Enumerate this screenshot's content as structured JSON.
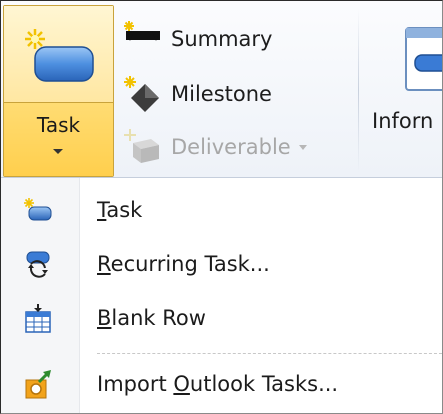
{
  "ribbon": {
    "task_button": {
      "label": "Task"
    },
    "items": [
      {
        "label": "Summary",
        "icon": "summary-icon",
        "enabled": true
      },
      {
        "label": "Milestone",
        "icon": "milestone-icon",
        "enabled": true
      },
      {
        "label": "Deliverable",
        "icon": "deliverable-icon",
        "enabled": false
      }
    ],
    "information": {
      "label": "Inforn",
      "icon": "information-icon"
    }
  },
  "menu": {
    "items": [
      {
        "pre": "",
        "key": "T",
        "post": "ask",
        "icon": "task-icon"
      },
      {
        "pre": "",
        "key": "R",
        "post": "ecurring Task...",
        "icon": "recurring-task-icon"
      },
      {
        "pre": "",
        "key": "B",
        "post": "lank Row",
        "icon": "blank-row-icon"
      },
      {
        "pre": "Import ",
        "key": "O",
        "post": "utlook Tasks...",
        "icon": "import-outlook-icon"
      }
    ]
  },
  "colors": {
    "accent_gold": "#ffcf4d",
    "task_bar_blue": "#3a7bd5",
    "ribbon_bg": "#eef2f8"
  }
}
